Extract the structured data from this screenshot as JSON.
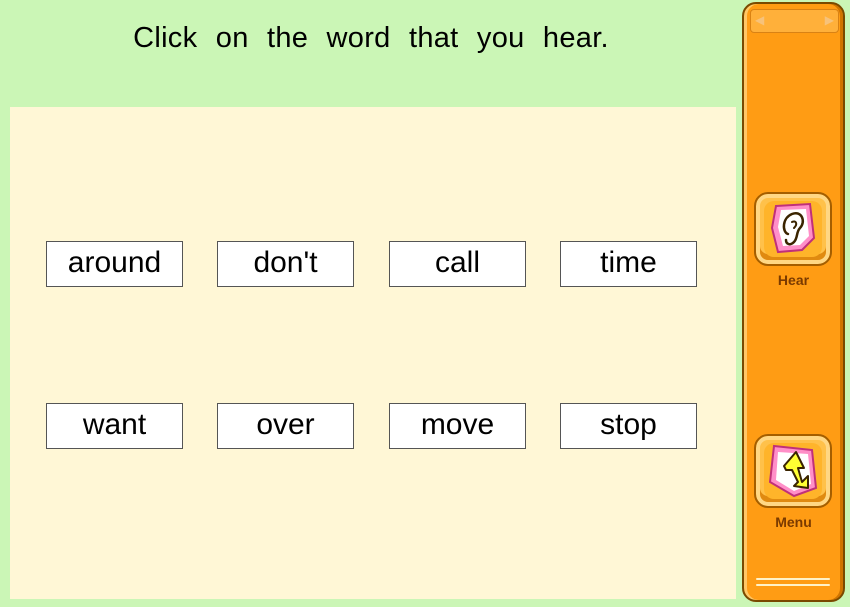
{
  "instruction": "Click on the word that you hear.",
  "words": [
    "around",
    "don't",
    "call",
    "time",
    "want",
    "over",
    "move",
    "stop"
  ],
  "side_panel": {
    "hear_label": "Hear",
    "hear_icon": "ear-icon",
    "menu_label": "Menu",
    "menu_icon": "return-arrow-icon",
    "scroll_left_glyph": "◀",
    "scroll_right_glyph": "▶"
  },
  "colors": {
    "header_bg": "#cbf6b6",
    "play_area_bg": "#fff7d6",
    "panel_orange": "#ff9c14"
  }
}
